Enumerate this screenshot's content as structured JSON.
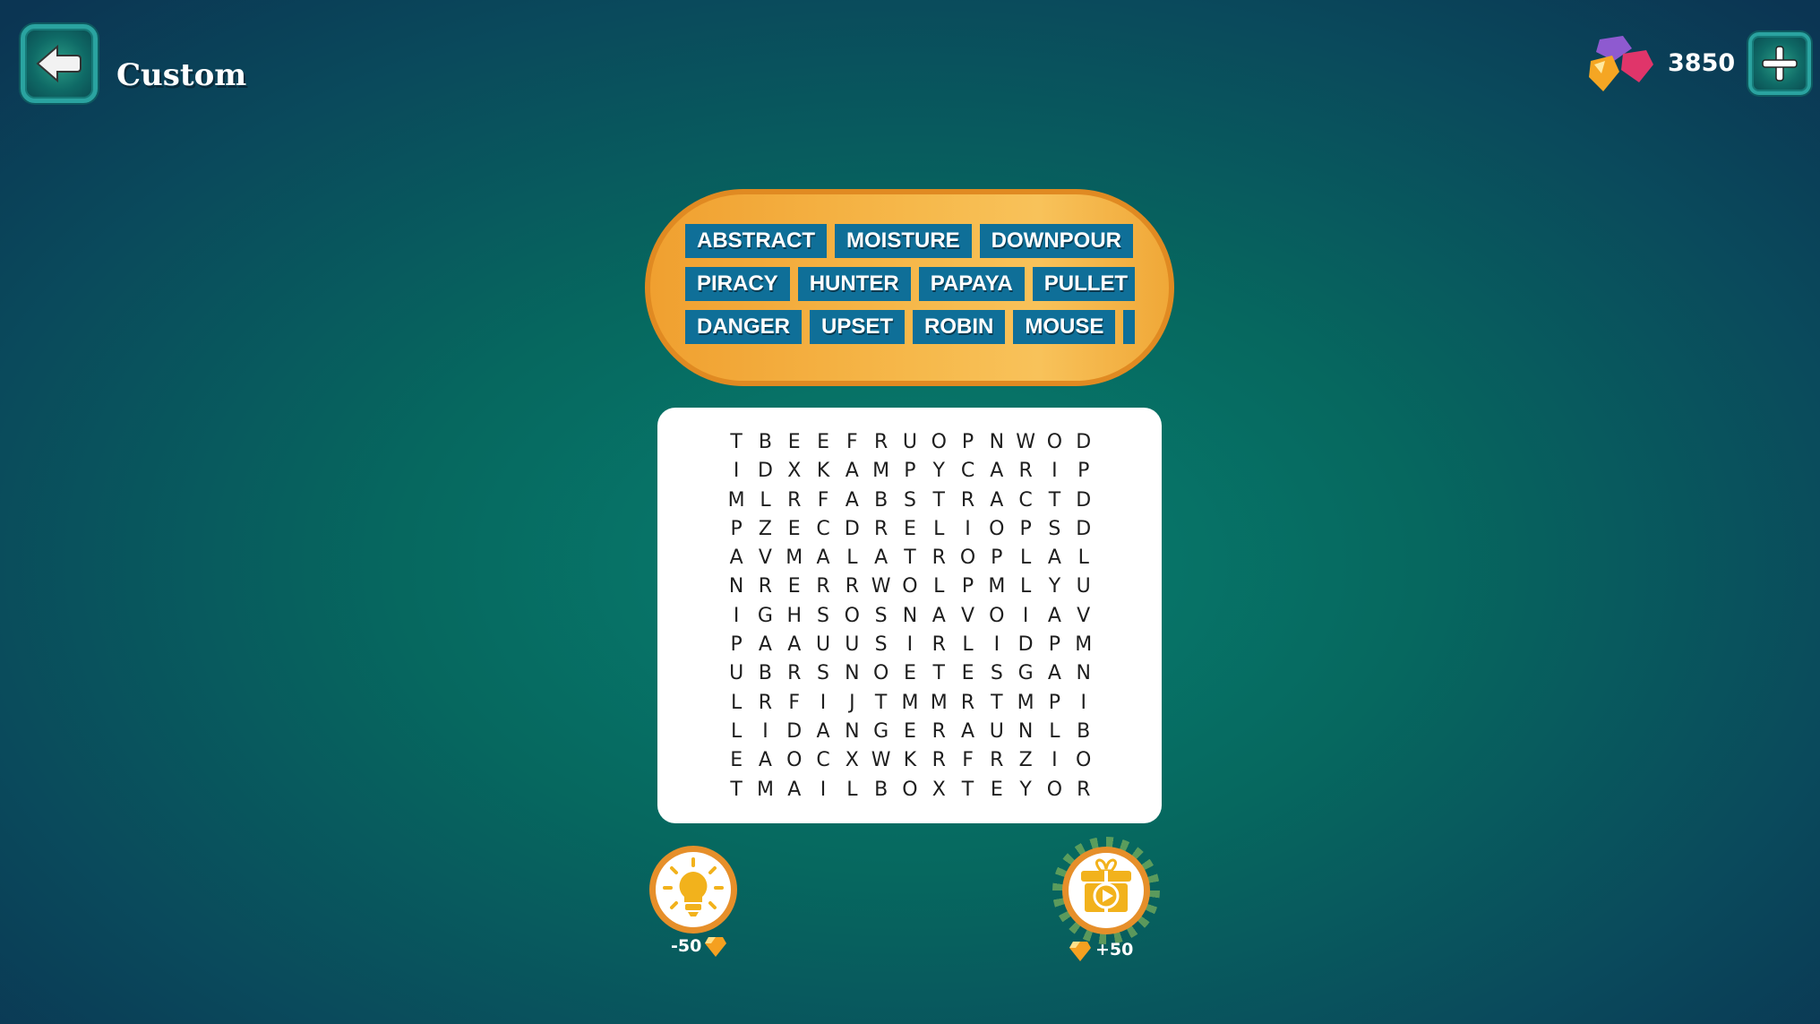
{
  "header": {
    "title": "Custom",
    "gems": "3850"
  },
  "colors": {
    "chip": "#0f6f98",
    "panel": "#f6b84a",
    "accent": "#e68f2a"
  },
  "words": [
    [
      "ABSTRACT",
      "MOISTURE",
      "DOWNPOUR"
    ],
    [
      "PIRACY",
      "HUNTER",
      "PAPAYA",
      "PULLET"
    ],
    [
      "DANGER",
      "UPSET",
      "ROBIN",
      "MOUSE",
      ""
    ]
  ],
  "grid": [
    "TBEEFRUOPNWOD",
    "IDXKAMPYCARIP",
    "MLRFABSTRACTD",
    "PZECDRELIOPSD",
    "AVMALATROPLAL",
    "NRERRWOLPMLYU",
    "IGHSOSNAVOIAV",
    "PAAUUSIRLIDPM",
    "UBRSNOETESGAN",
    "LRFIJTMMRTMPI",
    "LIDANGERAUNLB",
    "EAOCXWKRFRZIO",
    "TMAILBOXTEYOR"
  ],
  "hint": {
    "cost": "-50"
  },
  "reward": {
    "amount": "+50"
  }
}
